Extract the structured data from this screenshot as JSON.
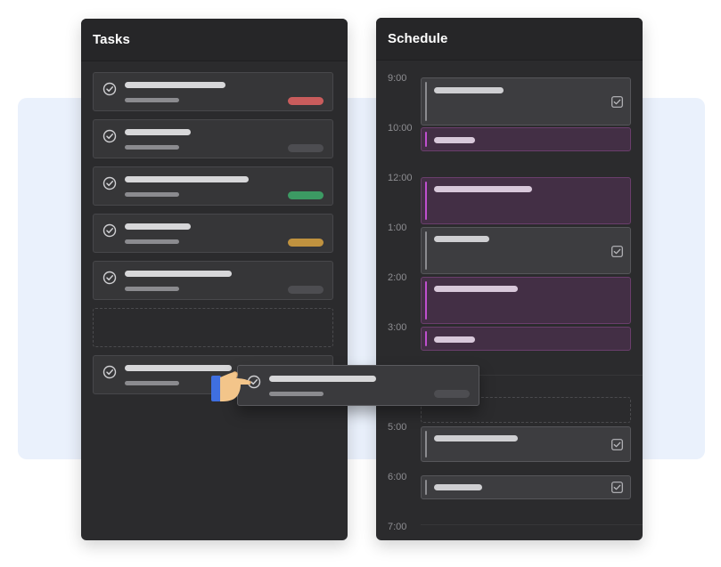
{
  "tasks_panel": {
    "title": "Tasks",
    "cards": [
      {
        "tag_color": "#c95c5c"
      },
      {
        "tag_color": "#4d4d51"
      },
      {
        "tag_color": "#3c9a63"
      },
      {
        "tag_color": "#c0923f"
      },
      {
        "tag_color": "#4d4d51"
      },
      {
        "placeholder": true
      },
      {
        "tag_color": "#4d4d51",
        "being_dragged": true
      }
    ]
  },
  "schedule_panel": {
    "title": "Schedule",
    "times": [
      "9:00",
      "10:00",
      "12:00",
      "1:00",
      "2:00",
      "3:00",
      "5:00",
      "6:00",
      "7:00"
    ]
  },
  "icons": {
    "task_check": "check-circle-icon",
    "event_check": "checkbox-checked-icon",
    "drag_hand": "grab-hand-icon"
  },
  "colors": {
    "panel_bg": "#2b2b2d",
    "event_purple": "#432f45",
    "purple_stripe": "#c04fcf",
    "background_band": "#eaf1fc",
    "drag_handle": "#3f6fe0"
  }
}
